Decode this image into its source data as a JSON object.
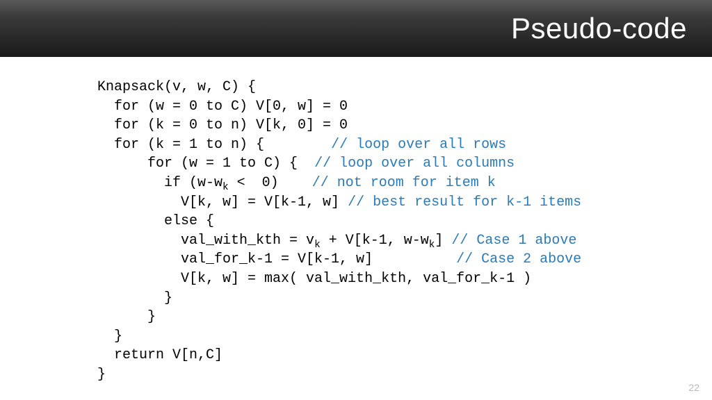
{
  "slide": {
    "title": "Pseudo-code",
    "page_number": "22"
  },
  "code": {
    "l01": "Knapsack(v, w, C) {",
    "l02": "  for (w = 0 to C) V[0, w] = 0",
    "l03": "  for (k = 0 to n) V[k, 0] = 0",
    "l04a": "  for (k = 1 to n) {        ",
    "l04c": "// loop over all rows",
    "l05a": "      for (w = 1 to C) {  ",
    "l05c": "// loop over all columns",
    "l06a": "        if (w-w",
    "l06b": " <  0)    ",
    "l06c": "// not room for item k",
    "l07a": "          V[k, w] = V[k-1, w] ",
    "l07c": "// best result for k-1 items",
    "l08": "        else {",
    "l09a": "          val_with_kth = v",
    "l09b": " + V[k-1, w-w",
    "l09c": "] ",
    "l09d": "// Case 1 above",
    "l10a": "          val_for_k-1 = V[k-1, w]          ",
    "l10c": "// Case 2 above",
    "l11": "          V[k, w] = max( val_with_kth, val_for_k-1 )",
    "l12": "        }",
    "l13": "      }",
    "l14": "  }",
    "l15": "  return V[n,C]",
    "l16": "}",
    "sub_k": "k"
  }
}
